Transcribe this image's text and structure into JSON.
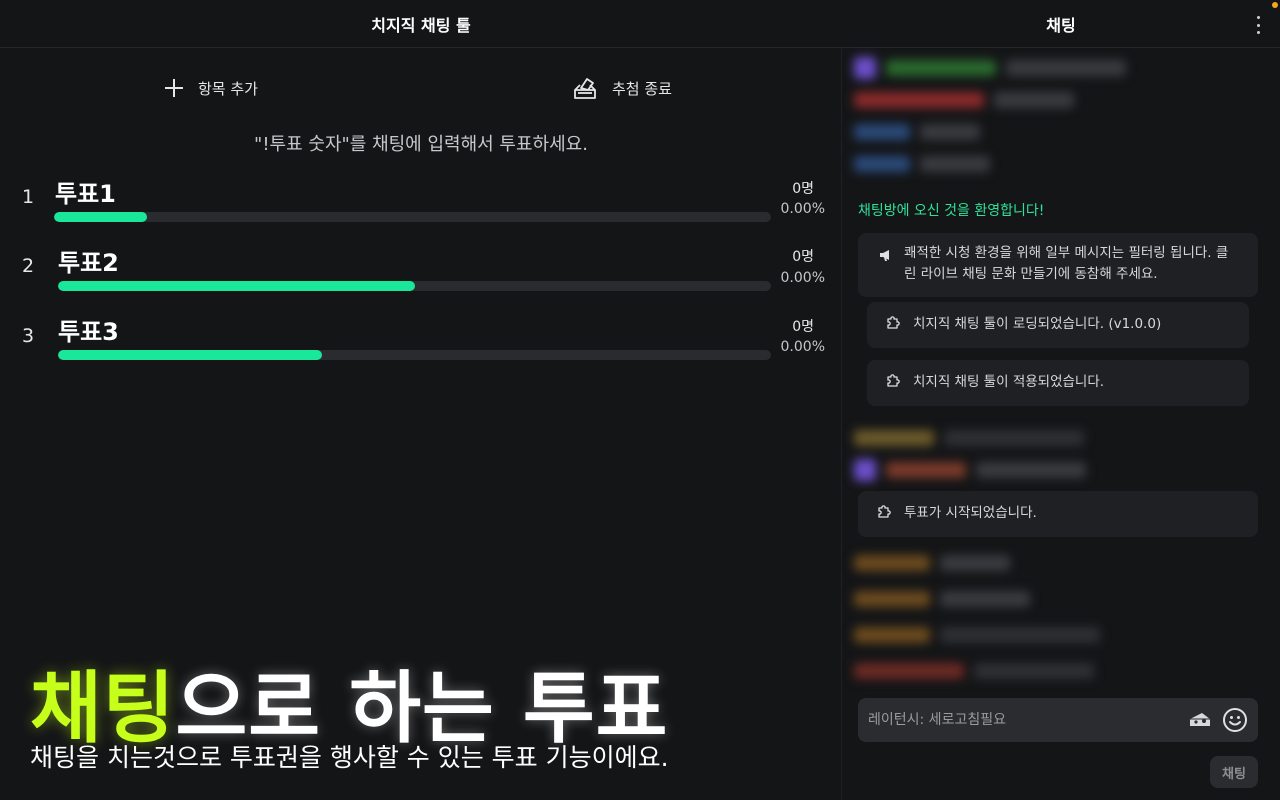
{
  "left_panel": {
    "title": "치지직 채팅 툴",
    "toolbar": {
      "add_item_label": "항목 추가",
      "end_vote_label": "추첨 종료"
    },
    "instruction": "\"!투표 숫자\"를 채팅에 입력해서 투표하세요.",
    "vote_items": [
      {
        "number": "1",
        "label": "투표1",
        "count": "0명",
        "percent": "0.00%",
        "bar_fill_fraction": 0.13
      },
      {
        "number": "2",
        "label": "투표2",
        "count": "0명",
        "percent": "0.00%",
        "bar_fill_fraction": 0.5
      },
      {
        "number": "3",
        "label": "투표3",
        "count": "0명",
        "percent": "0.00%",
        "bar_fill_fraction": 0.37
      }
    ]
  },
  "promo": {
    "title_accent": "채팅",
    "title_rest": "으로 하는 투표",
    "subtitle": "채팅을 치는것으로 투표권을 행사할 수 있는 투표 기능이에요."
  },
  "chat": {
    "title": "채팅",
    "welcome_message": "채팅방에 오신 것을 환영합니다!",
    "notices": [
      "쾌적한 시청 환경을 위해 일부 메시지는 필터링 됩니다. 클린 라이브 채팅 문화 만들기에 동참해 주세요.",
      "치지직 채팅 툴이 로딩되었습니다. (v1.0.0)",
      "치지직 채팅 툴이 적용되었습니다.",
      "투표가 시작되었습니다."
    ],
    "input_placeholder": "레이턴시: 세로고침필요",
    "send_label": "채팅"
  },
  "colors": {
    "accent_green": "#19e79a",
    "promo_lime": "#c6ff1a",
    "welcome_green": "#2ee29a"
  }
}
